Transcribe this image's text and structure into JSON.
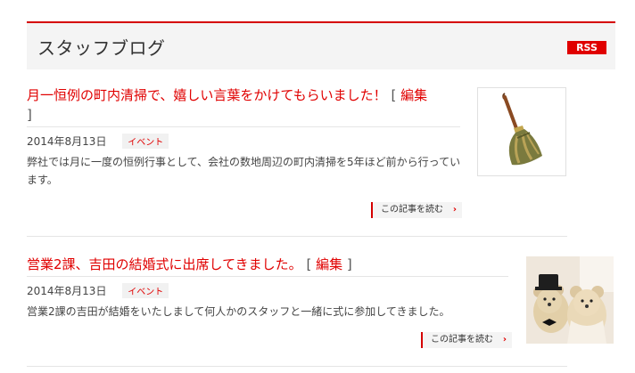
{
  "header": {
    "title": "スタッフブログ",
    "rss_label": "RSS"
  },
  "posts": [
    {
      "title": "月一恒例の町内清掃で、嬉しい言葉をかけてもらいました！",
      "edit_label": "編集",
      "bracket_open": "[",
      "bracket_close": "]",
      "date": "2014年8月13日",
      "category": "イベント",
      "excerpt": "弊社では月に一度の恒例行事として、会社の数地周辺の町内清掃を5年ほど前から行っています。",
      "read_more": "この記事を読む",
      "thumbnail_icon": "broom-icon"
    },
    {
      "title": "営業2課、吉田の結婚式に出席してきました。",
      "edit_label": "編集",
      "bracket_open": "[",
      "bracket_close": "]",
      "date": "2014年8月13日",
      "category": "イベント",
      "excerpt": "営業2課の吉田が結婚をいたしまして何人かのスタッフと一緒に式に参加してきました。",
      "read_more": "この記事を読む",
      "thumbnail_icon": "teddy-bears-photo"
    }
  ],
  "colors": {
    "accent": "#e00000",
    "header_bg": "#f4f4f4",
    "tag_bg": "#f1f1f1"
  }
}
